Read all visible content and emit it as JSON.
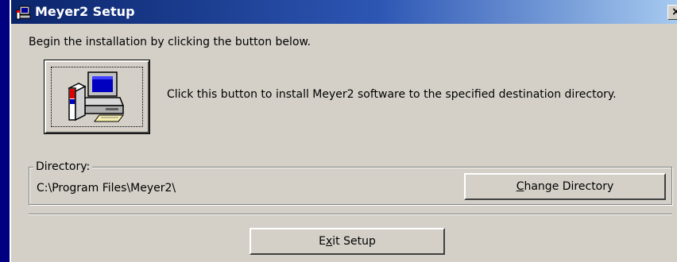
{
  "window": {
    "title": "Meyer2 Setup",
    "close_glyph": "×",
    "icons": {
      "app": "setup-computer-icon",
      "close": "close-icon"
    }
  },
  "intro_text": "Begin the installation by clicking the button below.",
  "install": {
    "icon": "install-computer-icon",
    "description": "Click this button to install Meyer2 software to the specified destination directory."
  },
  "directory": {
    "legend": "Directory:",
    "path": "C:\\Program Files\\Meyer2\\",
    "change_button": {
      "mnemonic": "C",
      "rest": "hange Directory"
    }
  },
  "exit_button": {
    "before": "E",
    "mnemonic": "x",
    "after": "it Setup"
  },
  "colors": {
    "face": "#d4d0c8",
    "titlebar_start": "#0a246a",
    "titlebar_end": "#a6caf0",
    "desktop": "#000080"
  }
}
